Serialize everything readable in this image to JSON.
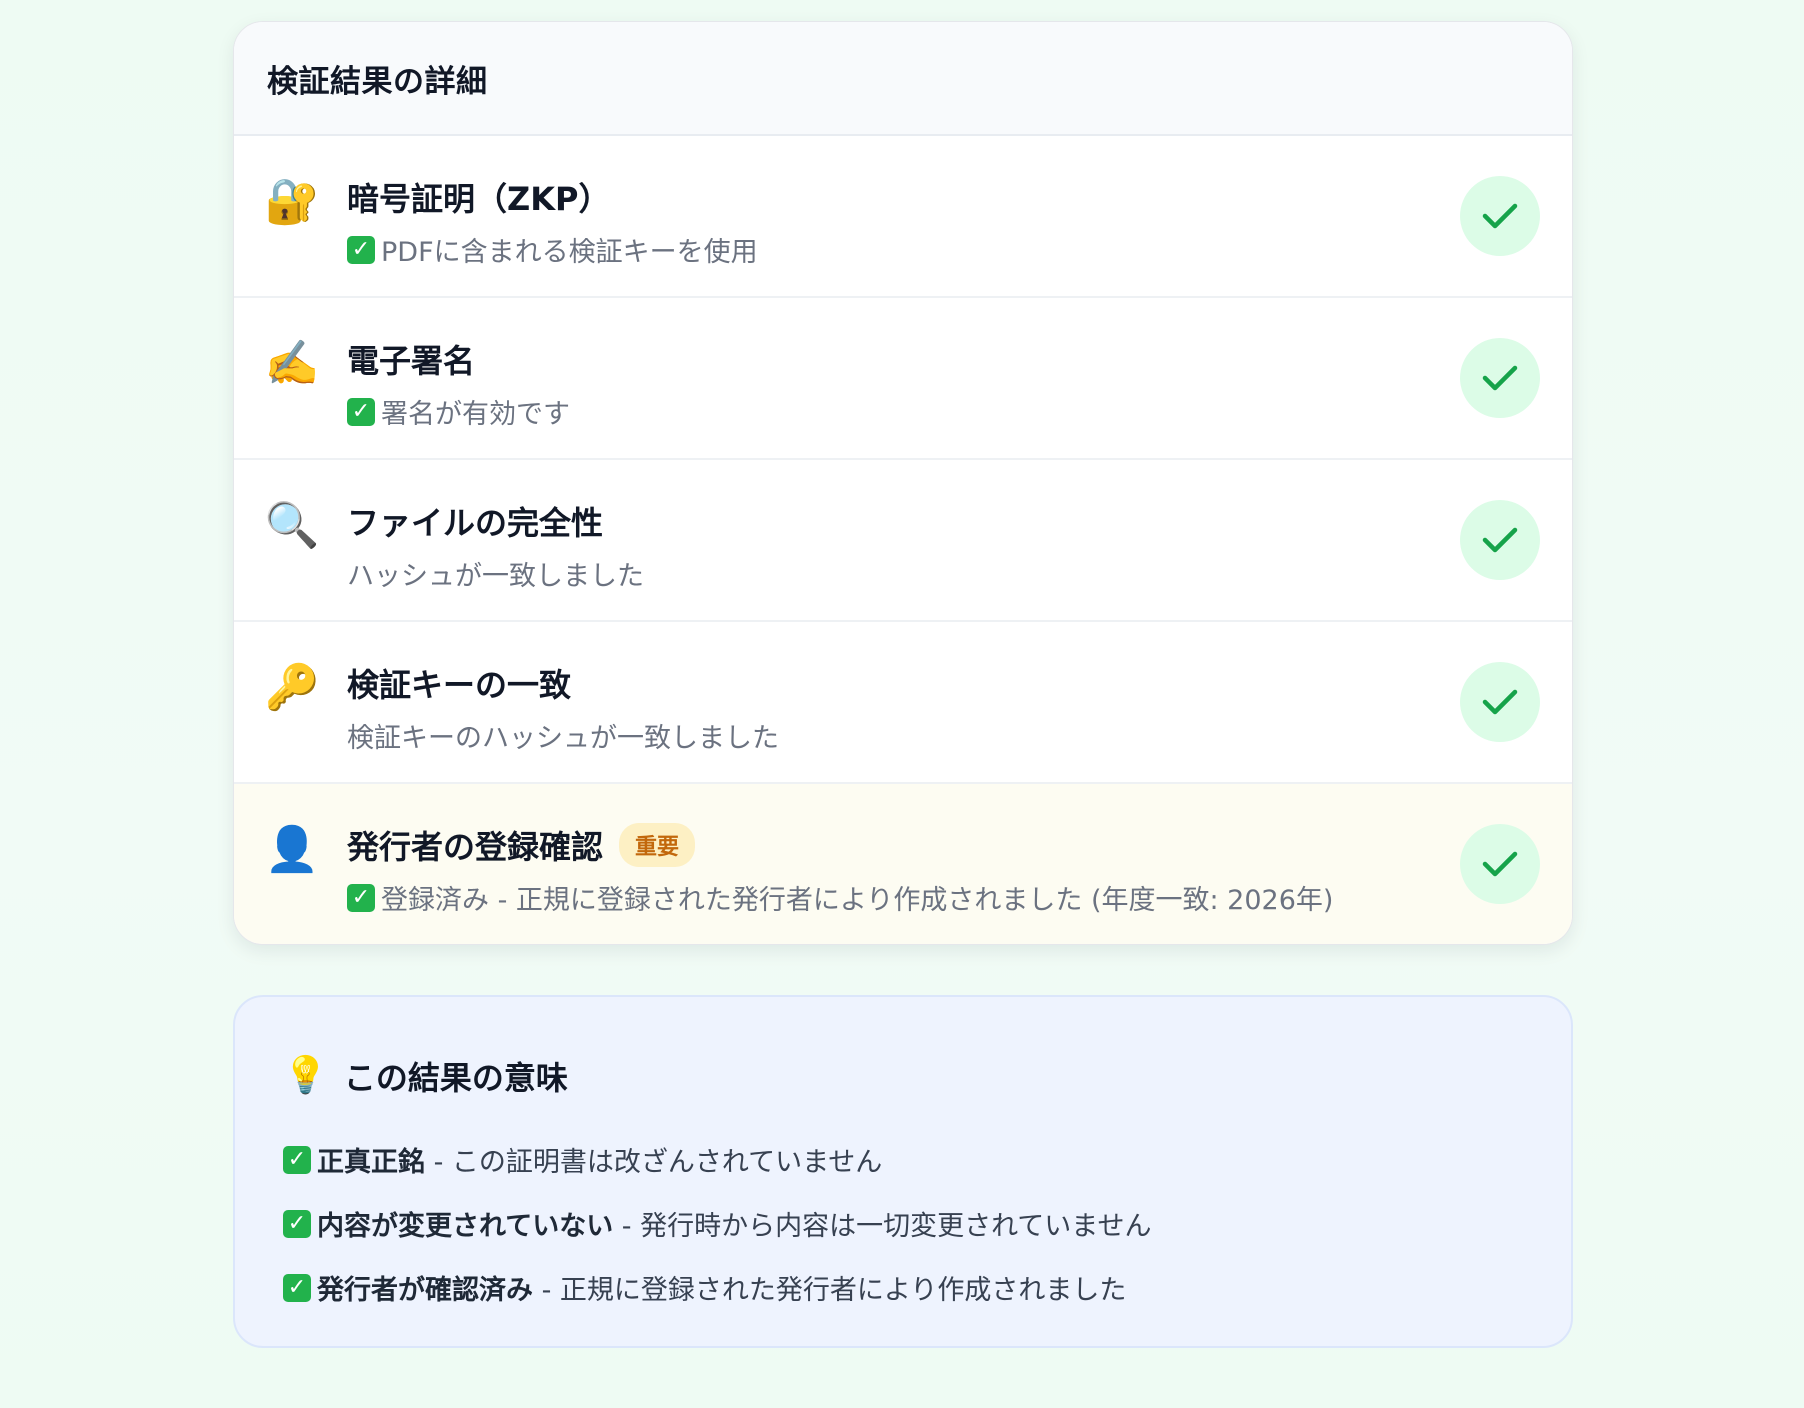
{
  "results": {
    "title": "検証結果の詳細",
    "rows": [
      {
        "icon": "🔐",
        "icon_name": "lock-with-key-icon",
        "title": "暗号証明（ZKP）",
        "has_check": true,
        "subtitle": "PDFに含まれる検証キーを使用"
      },
      {
        "icon": "✍️",
        "icon_name": "writing-hand-icon",
        "title": "電子署名",
        "has_check": true,
        "subtitle": "署名が有効です"
      },
      {
        "icon": "🔍",
        "icon_name": "magnifier-icon",
        "title": "ファイルの完全性",
        "has_check": false,
        "subtitle": "ハッシュが一致しました"
      },
      {
        "icon": "🔑",
        "icon_name": "key-icon",
        "title": "検証キーの一致",
        "has_check": false,
        "subtitle": "検証キーのハッシュが一致しました"
      },
      {
        "icon": "👤",
        "icon_name": "user-icon",
        "title": "発行者の登録確認",
        "badge": "重要",
        "has_check": true,
        "subtitle": "登録済み - 正規に登録された発行者により作成されました (年度一致: 2026年)"
      }
    ]
  },
  "meaning": {
    "icon": "💡",
    "title": "この結果の意味",
    "items": [
      {
        "bold": "正真正銘",
        "text": " - この証明書は改ざんされていません"
      },
      {
        "bold": "内容が変更されていない",
        "text": " - 発行時から内容は一切変更されていません"
      },
      {
        "bold": "発行者が確認済み",
        "text": " - 正規に登録された発行者により作成されました"
      }
    ]
  },
  "colors": {
    "success": "#22b24c",
    "success_bg": "#dcfce7",
    "badge_text": "#c2680c",
    "badge_bg": "#fdf0c4"
  }
}
